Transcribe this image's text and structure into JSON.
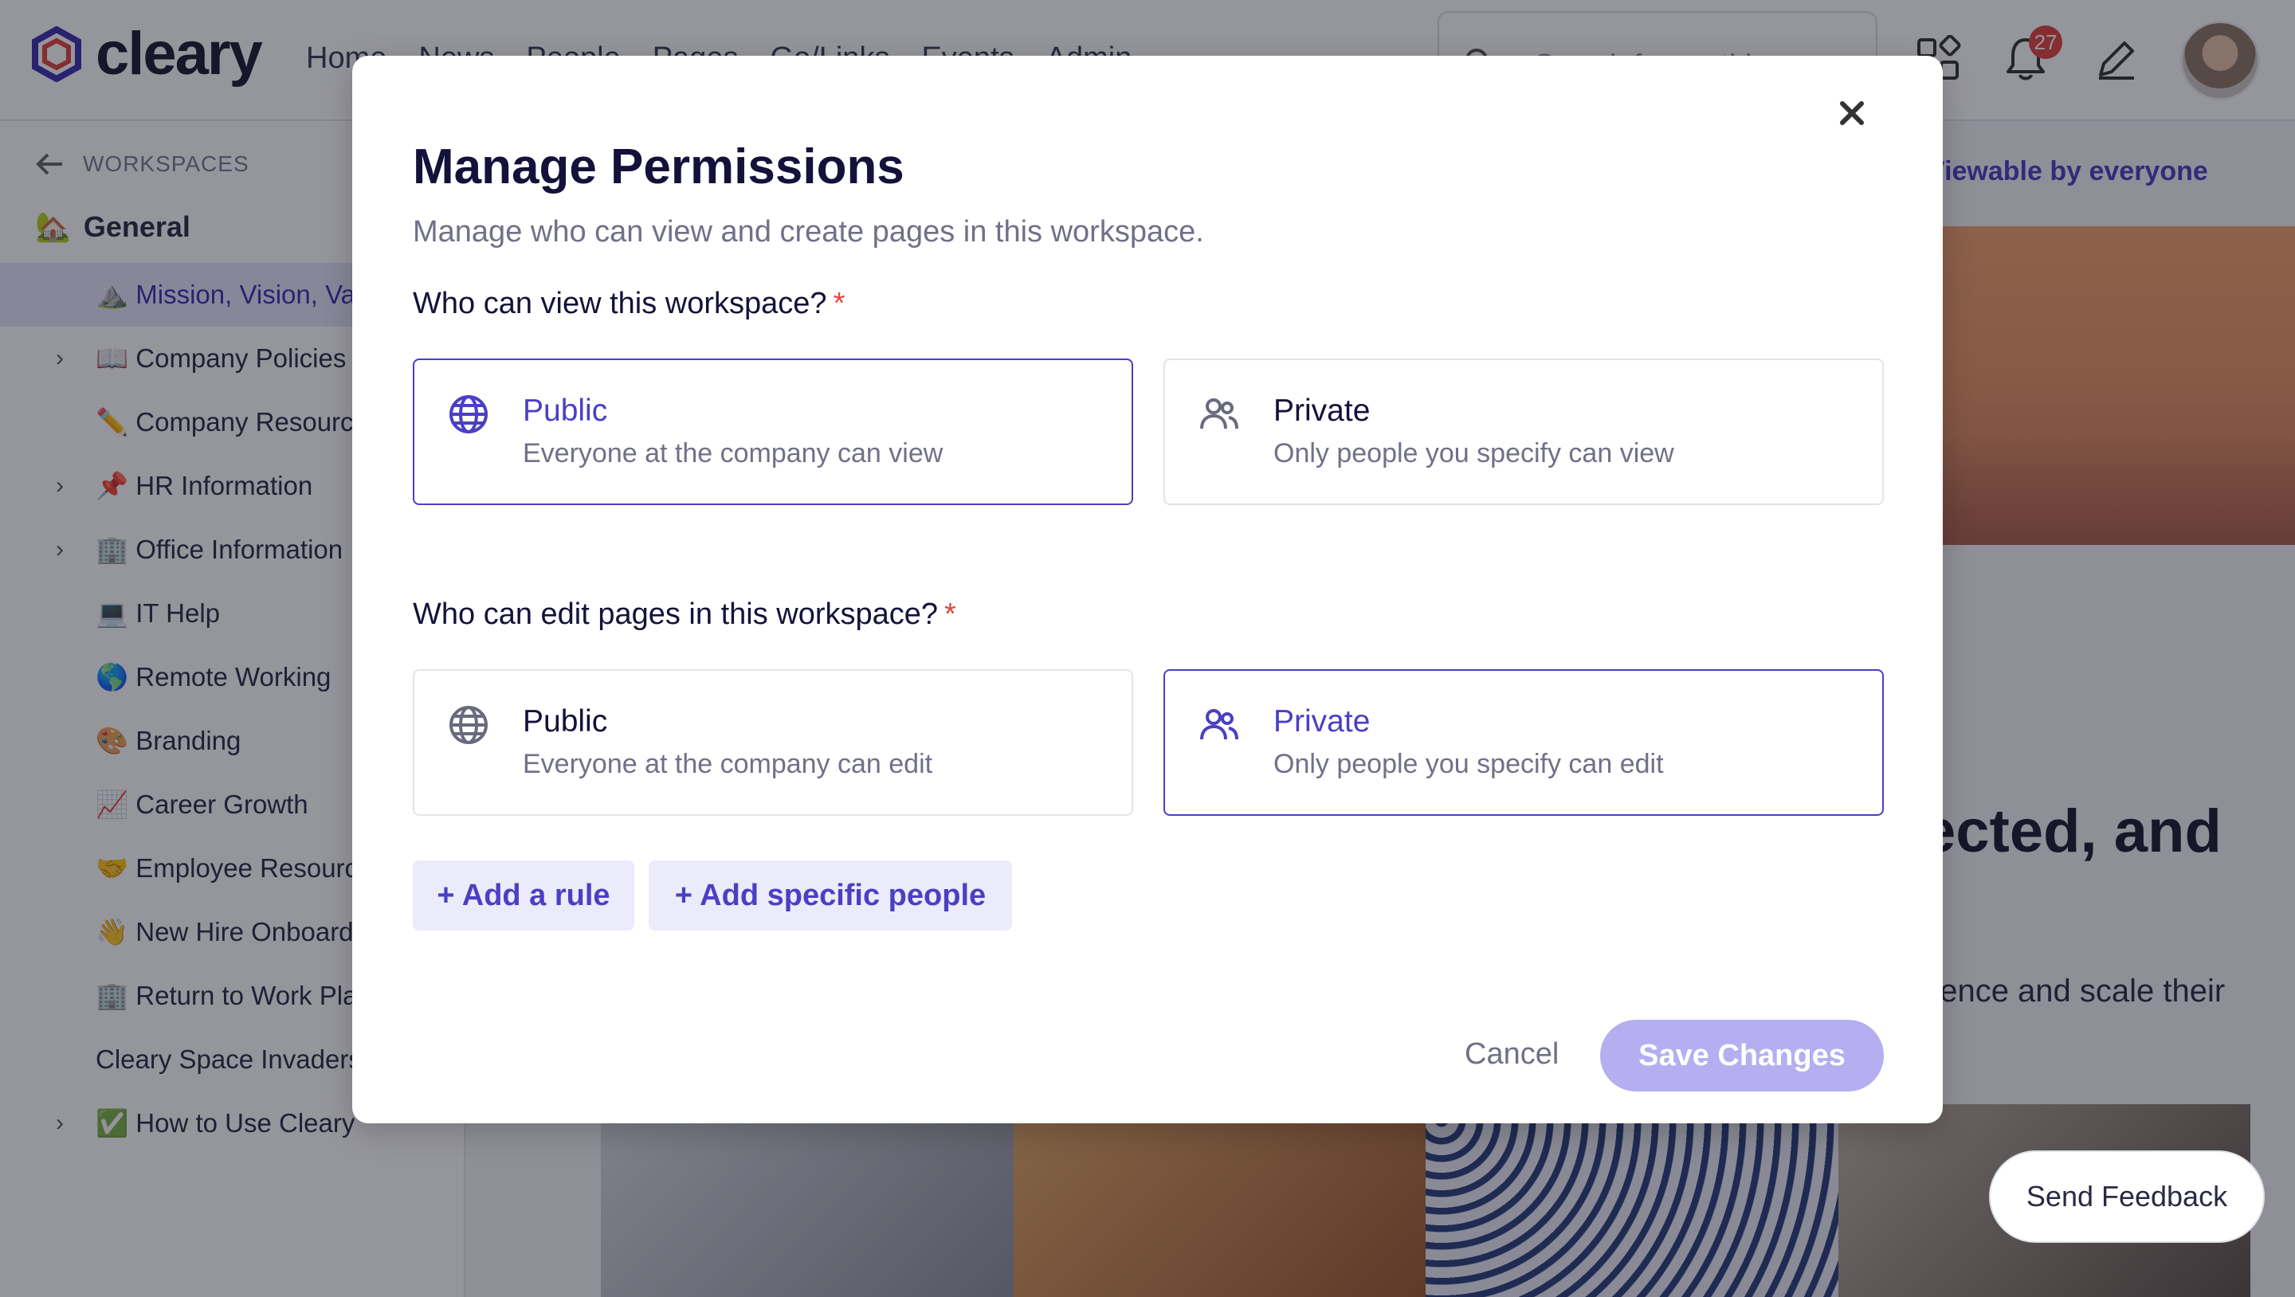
{
  "app": {
    "brand": "cleary"
  },
  "nav": [
    "Home",
    "News",
    "People",
    "Pages",
    "Go/Links",
    "Events",
    "Admin"
  ],
  "search": {
    "placeholder": "Search for anything"
  },
  "notifications": {
    "count": "27"
  },
  "sidebar": {
    "back_label": "WORKSPACES",
    "workspace": "General",
    "items": [
      {
        "label": "⛰️ Mission, Vision, Values",
        "chevron": false,
        "active": true
      },
      {
        "label": "📖 Company Policies",
        "chevron": true
      },
      {
        "label": "✏️ Company Resources",
        "chevron": false
      },
      {
        "label": "📌 HR Information",
        "chevron": true
      },
      {
        "label": "🏢 Office Information",
        "chevron": true
      },
      {
        "label": "💻 IT Help",
        "chevron": false
      },
      {
        "label": "🌎 Remote Working",
        "chevron": false
      },
      {
        "label": "🎨 Branding",
        "chevron": false
      },
      {
        "label": "📈 Career Growth",
        "chevron": false
      },
      {
        "label": "🤝 Employee Resources",
        "chevron": false
      },
      {
        "label": "👋 New Hire Onboarding",
        "chevron": false
      },
      {
        "label": "🏢 Return to Work Plan",
        "chevron": false
      },
      {
        "label": "Cleary Space Invaders",
        "chevron": false
      },
      {
        "label": "✅ How to Use Cleary",
        "chevron": true
      }
    ]
  },
  "main": {
    "visibility": "Viewable by everyone",
    "heading_fragment": "ected, and",
    "text_fragment": "rience and scale their"
  },
  "feedback": {
    "label": "Send Feedback"
  },
  "modal": {
    "title": "Manage Permissions",
    "subtitle": "Manage who can view and create pages in this workspace.",
    "view_question": "Who can view this workspace?",
    "edit_question": "Who can edit pages in this workspace?",
    "required_mark": "*",
    "view_options": [
      {
        "title": "Public",
        "desc": "Everyone at the company can view",
        "selected": true
      },
      {
        "title": "Private",
        "desc": "Only people you specify can view",
        "selected": false
      }
    ],
    "edit_options": [
      {
        "title": "Public",
        "desc": "Everyone at the company can edit",
        "selected": false
      },
      {
        "title": "Private",
        "desc": "Only people you specify can edit",
        "selected": true
      }
    ],
    "add_rule": "+ Add a rule",
    "add_people": "+ Add specific people",
    "cancel": "Cancel",
    "save": "Save Changes"
  },
  "colors": {
    "accent": "#4b3fc4",
    "required": "#e0443c",
    "save_disabled": "#b5aef0"
  }
}
